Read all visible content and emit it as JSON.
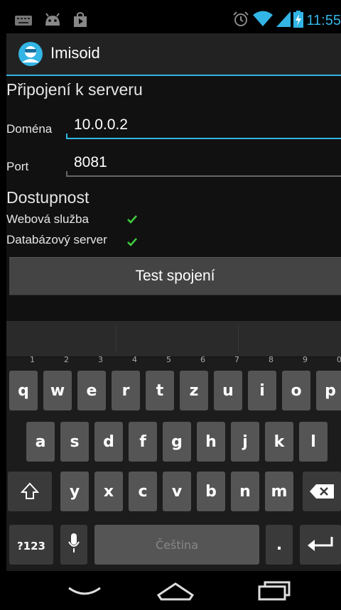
{
  "status_bar": {
    "time": "11:55",
    "icons_left": [
      "keyboard-icon",
      "android-icon",
      "play-store-icon"
    ],
    "icons_right": [
      "alarm-icon",
      "wifi-icon",
      "signal-icon",
      "battery-charging-icon"
    ]
  },
  "action_bar": {
    "title": "Imisoid",
    "icon": "app-icon"
  },
  "content": {
    "server_section": "Připojení k serveru",
    "domain_label": "Doména",
    "domain_value": "10.0.0.2",
    "port_label": "Port",
    "port_value": "8081",
    "availability_section": "Dostupnost",
    "web_service_label": "Webová služba",
    "db_server_label": "Databázový server",
    "test_button": "Test spojení"
  },
  "keyboard": {
    "row1": [
      {
        "k": "q",
        "n": "1"
      },
      {
        "k": "w",
        "n": "2"
      },
      {
        "k": "e",
        "n": "3"
      },
      {
        "k": "r",
        "n": "4"
      },
      {
        "k": "t",
        "n": "5"
      },
      {
        "k": "z",
        "n": "6"
      },
      {
        "k": "u",
        "n": "7"
      },
      {
        "k": "i",
        "n": "8"
      },
      {
        "k": "o",
        "n": "9"
      },
      {
        "k": "p",
        "n": "0"
      }
    ],
    "row2": [
      "a",
      "s",
      "d",
      "f",
      "g",
      "h",
      "j",
      "k",
      "l"
    ],
    "row3": [
      "y",
      "x",
      "c",
      "v",
      "b",
      "n",
      "m"
    ],
    "symbols_key": "?123",
    "space_label": "Čeština",
    "period_key": "."
  }
}
